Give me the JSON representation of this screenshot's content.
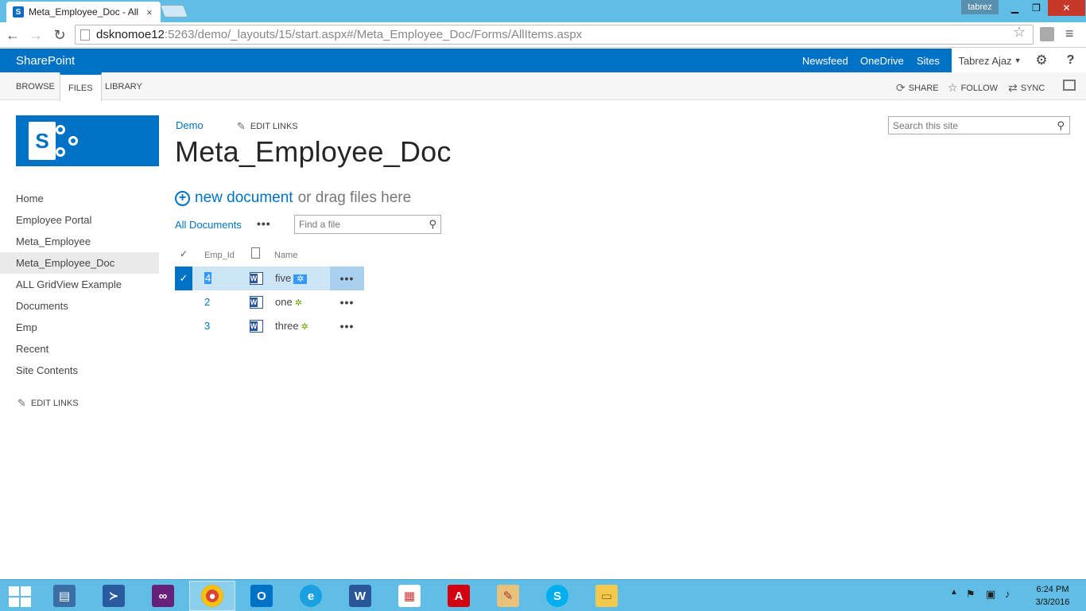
{
  "browser": {
    "tab_title": "Meta_Employee_Doc - All",
    "tab_close": "×",
    "profile_name": "tabrez",
    "url_host": "dsknomoe12",
    "url_rest": ":5263/demo/_layouts/15/start.aspx#/Meta_Employee_Doc/Forms/AllItems.aspx"
  },
  "suitebar": {
    "brand": "SharePoint",
    "links": [
      "Newsfeed",
      "OneDrive",
      "Sites"
    ],
    "user": "Tabrez Ajaz",
    "help": "?"
  },
  "ribbon": {
    "tabs": [
      "BROWSE",
      "FILES",
      "LIBRARY"
    ],
    "actions": [
      "SHARE",
      "FOLLOW",
      "SYNC"
    ]
  },
  "header": {
    "breadcrumb": "Demo",
    "edit_links": "EDIT LINKS",
    "page_title": "Meta_Employee_Doc",
    "search_placeholder": "Search this site"
  },
  "quicklaunch": {
    "items": [
      "Home",
      "Employee Portal",
      "Meta_Employee",
      "Meta_Employee_Doc",
      "ALL GridView Example",
      "Documents",
      "Emp",
      "Recent",
      "Site Contents"
    ],
    "edit_links": "EDIT LINKS"
  },
  "library": {
    "new_document": "new document",
    "drag_text": "or drag files here",
    "view_name": "All Documents",
    "find_placeholder": "Find a file",
    "columns": {
      "emp_id": "Emp_Id",
      "name": "Name"
    },
    "rows": [
      {
        "emp_id": "4",
        "name": "five",
        "selected": true
      },
      {
        "emp_id": "2",
        "name": "one",
        "selected": false
      },
      {
        "emp_id": "3",
        "name": "three",
        "selected": false
      }
    ]
  },
  "taskbar": {
    "time": "6:24 PM",
    "date": "3/3/2016"
  },
  "colors": {
    "suite_blue": "#0072c6",
    "taskbar": "#5fbde6",
    "selection": "#cde6f7"
  }
}
